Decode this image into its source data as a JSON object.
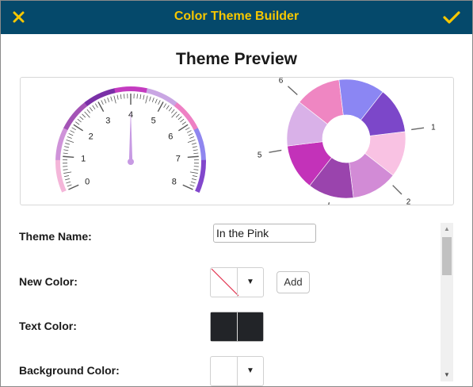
{
  "window": {
    "title": "Color Theme Builder"
  },
  "preview": {
    "heading": "Theme Preview"
  },
  "gauge": {
    "tick_labels": [
      "0",
      "1",
      "2",
      "3",
      "4",
      "5",
      "6",
      "7",
      "8"
    ],
    "value": 4,
    "band_colors": [
      "#f4b6d9",
      "#cf93d9",
      "#a454b6",
      "#7a30a7",
      "#c43bc0",
      "#c9a6e3",
      "#ee80c4",
      "#8f86ef",
      "#8247cc"
    ],
    "needle_color": "#c79ae3"
  },
  "donut": {
    "labels": [
      "1",
      "2",
      "5",
      "6"
    ],
    "segment_colors": [
      "#f9c2e3",
      "#d28bd6",
      "#9a44ad",
      "#c332b9",
      "#d9b1e8",
      "#ef86c2",
      "#8b86f3",
      "#7c47c9"
    ]
  },
  "form": {
    "theme_name_label": "Theme Name:",
    "theme_name_value": "In the Pink",
    "new_color_label": "New Color:",
    "add_label": "Add",
    "text_color_label": "Text Color:",
    "text_color_value": "#222428",
    "background_color_label": "Background Color:",
    "dropdown_arrow": "▼"
  },
  "scrollbar": {
    "up": "▲",
    "down": "▼"
  },
  "icons": {
    "close": "close-icon",
    "confirm": "check-icon"
  },
  "colors": {
    "titlebar": "#05496b",
    "title_text": "#f6c700"
  }
}
